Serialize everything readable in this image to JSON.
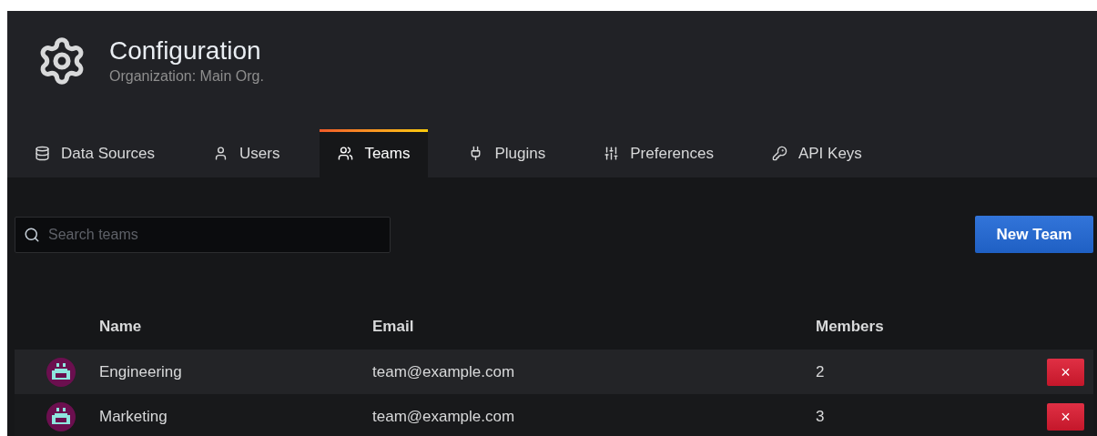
{
  "header": {
    "title": "Configuration",
    "subtitle": "Organization: Main Org."
  },
  "tabs": [
    {
      "label": "Data Sources",
      "selected": false
    },
    {
      "label": "Users",
      "selected": false
    },
    {
      "label": "Teams",
      "selected": true
    },
    {
      "label": "Plugins",
      "selected": false
    },
    {
      "label": "Preferences",
      "selected": false
    },
    {
      "label": "API Keys",
      "selected": false
    }
  ],
  "search": {
    "placeholder": "Search teams"
  },
  "new_button": "New Team",
  "table": {
    "columns": [
      "Name",
      "Email",
      "Members"
    ],
    "rows": [
      {
        "name": "Engineering",
        "email": "team@example.com",
        "members": "2",
        "delete": "×",
        "highlighted": true
      },
      {
        "name": "Marketing",
        "email": "team@example.com",
        "members": "3",
        "delete": "×",
        "highlighted": false
      }
    ]
  }
}
